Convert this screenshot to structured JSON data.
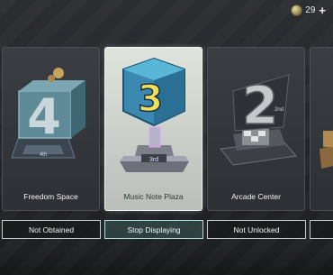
{
  "header": {
    "currency_amount": "29"
  },
  "cards": [
    {
      "name": "Freedom Space",
      "button": "Not Obtained",
      "selected": false
    },
    {
      "name": "Music Note Plaza",
      "button": "Stop Displaying",
      "selected": true
    },
    {
      "name": "Arcade Center",
      "button": "Not Unlocked",
      "selected": false
    }
  ],
  "trophies": {
    "first_badge": "4th",
    "second_numeral": "3",
    "second_badge": "3rd",
    "third_numeral": "2",
    "third_badge": "2nd"
  },
  "colors": {
    "accent": "#a8e0d8",
    "selected_card": "#dfe4dc"
  }
}
